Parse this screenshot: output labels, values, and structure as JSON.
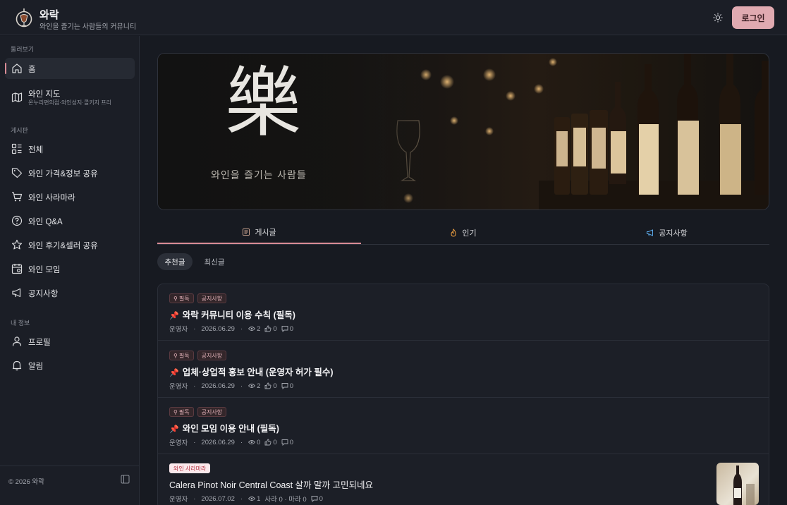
{
  "header": {
    "brand_title": "와락",
    "brand_subtitle": "와인을 즐기는 사람들의 커뮤니티",
    "login_label": "로그인"
  },
  "sidebar": {
    "section_browse": "둘러보기",
    "section_board": "게시판",
    "section_my": "내 정보",
    "items": [
      {
        "label": "홈",
        "icon": "home-icon"
      },
      {
        "label": "와인 지도",
        "sublabel": "온누리편의점·와인성지·콜키지 프리",
        "icon": "map-icon"
      },
      {
        "label": "전체",
        "icon": "grid-list-icon"
      },
      {
        "label": "와인 가격&정보 공유",
        "icon": "tag-icon"
      },
      {
        "label": "와인 사라마라",
        "icon": "cart-icon"
      },
      {
        "label": "와인 Q&A",
        "icon": "question-icon"
      },
      {
        "label": "와인 후기&셀러 공유",
        "icon": "star-icon"
      },
      {
        "label": "와인 모임",
        "icon": "calendar-icon"
      },
      {
        "label": "공지사항",
        "icon": "megaphone-icon"
      },
      {
        "label": "프로필",
        "icon": "user-icon"
      },
      {
        "label": "알림",
        "icon": "bell-icon"
      }
    ],
    "copyright": "© 2026 와락"
  },
  "hero": {
    "character": "樂",
    "caption": "와인을 즐기는 사람들"
  },
  "tabs": [
    {
      "label": "게시글",
      "icon": "document-icon",
      "active": true
    },
    {
      "label": "인기",
      "icon": "flame-icon",
      "active": false
    },
    {
      "label": "공지사항",
      "icon": "megaphone-icon",
      "active": false
    }
  ],
  "sort": {
    "recommended": "추천글",
    "latest": "최신글"
  },
  "posts": [
    {
      "badges": [
        "필독",
        "공지사항"
      ],
      "title": "와락 커뮤니티 이용 수칙 (필독)",
      "author": "운영자",
      "date": "2026.06.29",
      "views": "2",
      "likes": "0",
      "comments": "0"
    },
    {
      "badges": [
        "필독",
        "공지사항"
      ],
      "title": "업체·상업적 홍보 안내 (운영자 허가 필수)",
      "author": "운영자",
      "date": "2026.06.29",
      "views": "2",
      "likes": "0",
      "comments": "0"
    },
    {
      "badges": [
        "필독",
        "공지사항"
      ],
      "title": "와인 모임 이용 안내 (필독)",
      "author": "운영자",
      "date": "2026.06.29",
      "views": "0",
      "likes": "0",
      "comments": "0"
    },
    {
      "badges": [
        "와인 사라마라"
      ],
      "title": "Calera Pinot Noir Central Coast 살까 말까 고민되네요",
      "author": "운영자",
      "date": "2026.07.02",
      "views": "1",
      "vote": "사라 0 · 마라 0",
      "comments": "0"
    }
  ],
  "colors": {
    "accent": "#e0aab1",
    "active_indicator": "#d98c96",
    "pin": "#e0515e"
  }
}
